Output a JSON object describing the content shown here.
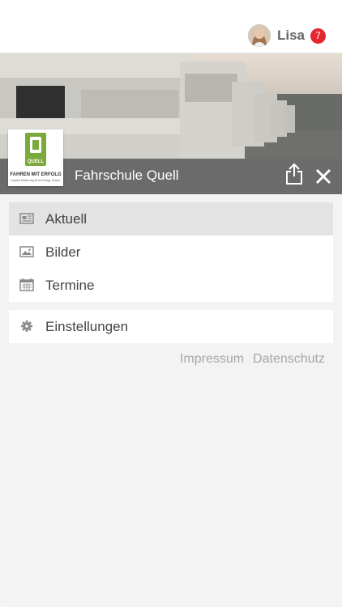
{
  "user": {
    "name": "Lisa",
    "badge_count": "7",
    "avatar_icon": "user-avatar"
  },
  "club": {
    "name": "Fahrschule Quell",
    "logo": {
      "mark": "QUELL",
      "title": "FAHREN MIT ERFOLG",
      "slogan": "Unsere Erfahrung ist Ihr Erfolg. Immer."
    }
  },
  "header_actions": {
    "share_icon": "share-icon",
    "close_icon": "close-icon"
  },
  "menu": {
    "items": [
      {
        "label": "Aktuell",
        "icon": "newspaper-icon",
        "active": true
      },
      {
        "label": "Bilder",
        "icon": "image-icon",
        "active": false
      },
      {
        "label": "Termine",
        "icon": "calendar-icon",
        "active": false
      }
    ],
    "settings": {
      "label": "Einstellungen",
      "icon": "gear-icon"
    }
  },
  "footer": {
    "impressum": "Impressum",
    "datenschutz": "Datenschutz"
  },
  "colors": {
    "badge": "#e3262f",
    "titlebar": "#6b6b6b",
    "active_item": "#e3e3e3",
    "logo_green": "#7aa93c"
  }
}
